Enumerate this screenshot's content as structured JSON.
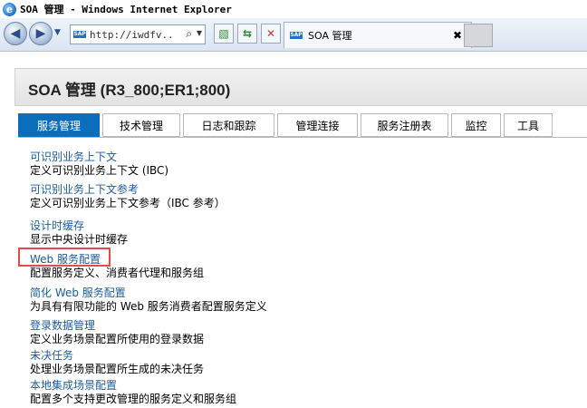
{
  "window": {
    "title": "SOA 管理 - Windows Internet Explorer",
    "logo_letter": "e"
  },
  "toolbar": {
    "back_icon": "back-arrow-icon",
    "forward_icon": "forward-arrow-icon",
    "address": "http://iwdfv...",
    "sap_label": "SAP",
    "tab_title": "SOA 管理",
    "tab_close": "✖"
  },
  "page": {
    "title": "SOA 管理  (R3_800;ER1;800)"
  },
  "tabs": [
    {
      "label": "服务管理",
      "active": true
    },
    {
      "label": "技术管理",
      "active": false
    },
    {
      "label": "日志和跟踪",
      "active": false
    },
    {
      "label": "管理连接",
      "active": false
    },
    {
      "label": "服务注册表",
      "active": false
    },
    {
      "label": "监控",
      "active": false
    },
    {
      "label": "工具",
      "active": false
    }
  ],
  "items": [
    {
      "link": "可识别业务上下文",
      "desc": "定义可识别业务上下文 (IBC)"
    },
    {
      "link": "可识别业务上下文参考",
      "desc": "定义可识别业务上下文参考（IBC 参考）"
    },
    {
      "link": "设计时缓存",
      "desc": "显示中央设计时缓存"
    },
    {
      "link": "Web 服务配置",
      "desc": "配置服务定义、消费者代理和服务组"
    },
    {
      "link": "简化 Web 服务配置",
      "desc": "为具有有限功能的 Web 服务消费者配置服务定义"
    },
    {
      "link": "登录数据管理",
      "desc": "定义业务场景配置所使用的登录数据"
    },
    {
      "link": "未决任务",
      "desc": "处理业务场景配置所生成的未决任务"
    },
    {
      "link": "本地集成场景配置",
      "desc": "配置多个支持更改管理的服务定义和服务组"
    }
  ],
  "colors": {
    "active_tab": "#0a6ebd",
    "link": "#1d5d98",
    "highlight": "#e64b4b"
  }
}
